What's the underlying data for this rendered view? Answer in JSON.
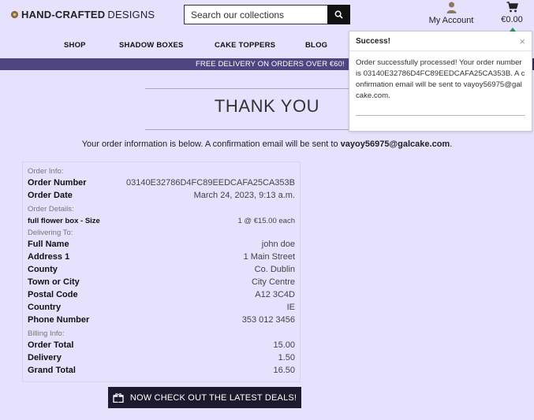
{
  "header": {
    "logo_bold": "HAND-CRAFTED",
    "logo_light": " DESIGNS",
    "search_placeholder": "Search our collections",
    "account_label": "My Account",
    "cart_total": "€0.00"
  },
  "nav": {
    "items": [
      "SHOP",
      "SHADOW BOXES",
      "CAKE TOPPERS",
      "BLOG"
    ]
  },
  "banner": {
    "text": "FREE DELIVERY ON ORDERS OVER €60!"
  },
  "checkout": {
    "title": "THANK YOU",
    "info_prefix": "Your order information is below. A confirmation email will be sent to ",
    "email": "vayoy56975@galcake.com",
    "info_suffix": "."
  },
  "order": {
    "section_order_info": "Order Info:",
    "order_number_label": "Order Number",
    "order_number": "03140E32786D4FC89EEDCAFA25CA353B",
    "order_date_label": "Order Date",
    "order_date": "March 24, 2023, 9:13 a.m.",
    "section_order_details": "Order Details:",
    "item_name": "full flower box - Size",
    "item_qty_price": "1 @ €15.00 each",
    "section_delivering": "Delivering To:",
    "full_name_label": "Full Name",
    "full_name": "john doe",
    "address1_label": "Address 1",
    "address1": "1 Main Street",
    "county_label": "County",
    "county": "Co. Dublin",
    "town_label": "Town or City",
    "town": "City Centre",
    "postcode_label": "Postal Code",
    "postcode": "A12 3C4D",
    "country_label": "Country",
    "country": "IE",
    "phone_label": "Phone Number",
    "phone": "353 012 3456",
    "section_billing": "Billing Info:",
    "order_total_label": "Order Total",
    "order_total": "15.00",
    "delivery_label": "Delivery",
    "delivery": "1.50",
    "grand_total_label": "Grand Total",
    "grand_total": "16.50"
  },
  "deals_button": "NOW CHECK OUT THE LATEST DEALS!",
  "toast": {
    "title": "Success!",
    "close": "×",
    "message": "Order successfully processed! Your order number is 03140E32786D4FC89EEDCAFA25CA353B. A confirmation email will be sent to vayoy56975@galcake.com."
  },
  "colors": {
    "background": "#e6e1fd",
    "banner": "#4e4680",
    "button_dark": "#1e1a2e",
    "toast_accent": "#1f9a4f"
  }
}
